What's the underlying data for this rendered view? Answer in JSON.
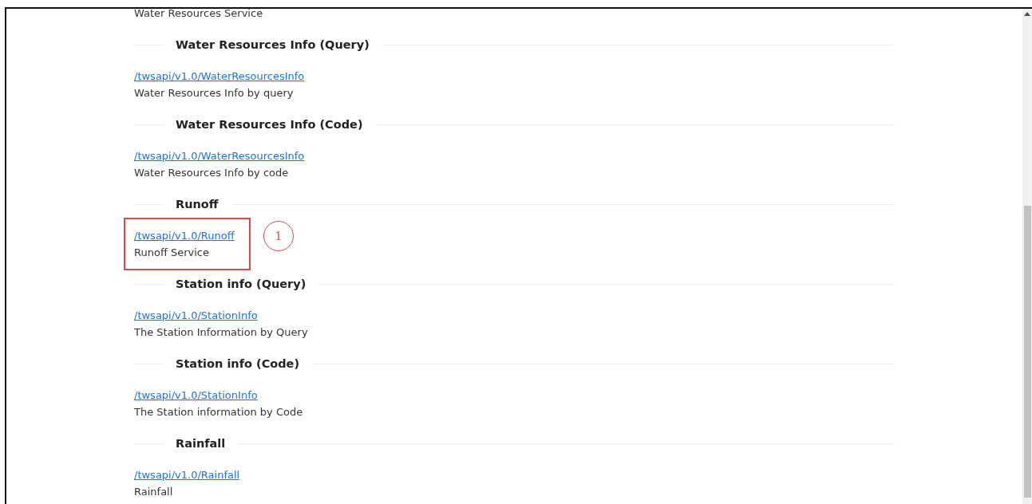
{
  "top_entry": {
    "description": "Water Resources Service"
  },
  "sections": [
    {
      "heading": "Water Resources Info (Query)",
      "link": "/twsapi/v1.0/WaterResourcesInfo",
      "description": "Water Resources Info by query",
      "highlighted": false
    },
    {
      "heading": "Water Resources Info (Code)",
      "link": "/twsapi/v1.0/WaterResourcesInfo",
      "description": "Water Resources Info by code",
      "highlighted": false
    },
    {
      "heading": "Runoff",
      "link": "/twsapi/v1.0/Runoff",
      "description": "Runoff Service",
      "highlighted": true,
      "marker": "1"
    },
    {
      "heading": "Station info (Query)",
      "link": "/twsapi/v1.0/StationInfo",
      "description": "The Station Information by Query",
      "highlighted": false
    },
    {
      "heading": "Station info (Code)",
      "link": "/twsapi/v1.0/StationInfo",
      "description": "The Station information by Code",
      "highlighted": false
    },
    {
      "heading": "Rainfall",
      "link": "/twsapi/v1.0/Rainfall",
      "description": "Rainfall",
      "highlighted": false
    }
  ]
}
